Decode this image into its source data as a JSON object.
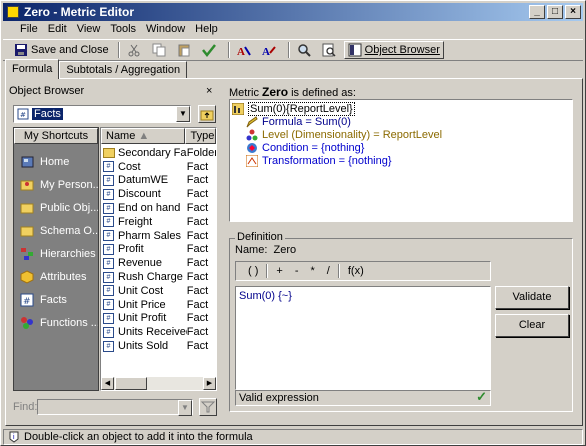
{
  "window": {
    "title": "Zero - Metric Editor"
  },
  "menu": [
    "File",
    "Edit",
    "View",
    "Tools",
    "Window",
    "Help"
  ],
  "toolbar": {
    "save_close": "Save and Close",
    "object_browser": "Object Browser"
  },
  "tabs": [
    "Formula",
    "Subtotals / Aggregation"
  ],
  "object_browser": {
    "title": "Object Browser",
    "close": "×",
    "folder": "Facts",
    "shortcuts_header": "My Shortcuts",
    "shortcuts": [
      {
        "label": "Home",
        "icon": "home-icon"
      },
      {
        "label": "My Person...",
        "icon": "person-icon"
      },
      {
        "label": "Public Obj...",
        "icon": "folder-icon"
      },
      {
        "label": "Schema O...",
        "icon": "folder-icon"
      },
      {
        "label": "Hierarchies",
        "icon": "hierarchy-icon"
      },
      {
        "label": "Attributes",
        "icon": "attribute-icon"
      },
      {
        "label": "Facts",
        "icon": "fact-icon"
      },
      {
        "label": "Functions ...",
        "icon": "function-icon"
      }
    ],
    "columns": [
      "Name",
      "Type"
    ],
    "items": [
      {
        "name": "Secondary Facts",
        "type": "Folder"
      },
      {
        "name": "Cost",
        "type": "Fact"
      },
      {
        "name": "DatumWE",
        "type": "Fact"
      },
      {
        "name": "Discount",
        "type": "Fact"
      },
      {
        "name": "End on hand",
        "type": "Fact"
      },
      {
        "name": "Freight",
        "type": "Fact"
      },
      {
        "name": "Pharm Sales",
        "type": "Fact"
      },
      {
        "name": "Profit",
        "type": "Fact"
      },
      {
        "name": "Revenue",
        "type": "Fact"
      },
      {
        "name": "Rush Charge",
        "type": "Fact"
      },
      {
        "name": "Unit Cost",
        "type": "Fact"
      },
      {
        "name": "Unit Price",
        "type": "Fact"
      },
      {
        "name": "Unit Profit",
        "type": "Fact"
      },
      {
        "name": "Units Received",
        "type": "Fact"
      },
      {
        "name": "Units Sold",
        "type": "Fact"
      }
    ],
    "find_label": "Find:"
  },
  "metric": {
    "prefix": "Metric",
    "name": "Zero",
    "suffix": "is defined as:",
    "tree": [
      {
        "text": "Sum(0){ReportLevel}",
        "color": "#000000"
      },
      {
        "text": "Formula = Sum(0)",
        "color": "#00008b"
      },
      {
        "text": "Level (Dimensionality) = ReportLevel",
        "color": "#8b6a00"
      },
      {
        "text": "Condition = {nothing}",
        "color": "#0000cd"
      },
      {
        "text": "Transformation = {nothing}",
        "color": "#0000cd"
      }
    ]
  },
  "definition": {
    "label": "Definition",
    "name_label": "Name:",
    "name_value": "Zero",
    "operators": [
      "( )",
      "+",
      "-",
      "*",
      "/",
      "f(x)"
    ],
    "expression": "Sum(0) {~}",
    "status": "Valid expression",
    "validate": "Validate",
    "clear": "Clear"
  },
  "status_bar": "Double-click an object to add it into the formula"
}
